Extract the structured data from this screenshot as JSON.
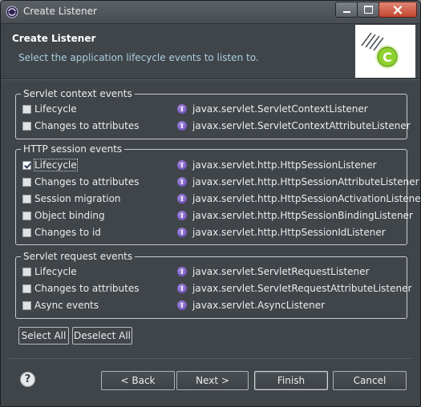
{
  "window": {
    "title": "Create Listener"
  },
  "banner": {
    "title": "Create Listener",
    "description": "Select the application lifecycle events to listen to."
  },
  "groups": [
    {
      "legend": "Servlet context events",
      "rows": [
        {
          "label": "Lifecycle",
          "checked": false,
          "interface": "javax.servlet.ServletContextListener"
        },
        {
          "label": "Changes to attributes",
          "checked": false,
          "interface": "javax.servlet.ServletContextAttributeListener"
        }
      ]
    },
    {
      "legend": "HTTP session events",
      "rows": [
        {
          "label": "Lifecycle",
          "checked": true,
          "interface": "javax.servlet.http.HttpSessionListener"
        },
        {
          "label": "Changes to attributes",
          "checked": false,
          "interface": "javax.servlet.http.HttpSessionAttributeListener"
        },
        {
          "label": "Session migration",
          "checked": false,
          "interface": "javax.servlet.http.HttpSessionActivationListener"
        },
        {
          "label": "Object binding",
          "checked": false,
          "interface": "javax.servlet.http.HttpSessionBindingListener"
        },
        {
          "label": "Changes to id",
          "checked": false,
          "interface": "javax.servlet.http.HttpSessionIdListener"
        }
      ]
    },
    {
      "legend": "Servlet request events",
      "rows": [
        {
          "label": "Lifecycle",
          "checked": false,
          "interface": "javax.servlet.ServletRequestListener"
        },
        {
          "label": "Changes to attributes",
          "checked": false,
          "interface": "javax.servlet.ServletRequestAttributeListener"
        },
        {
          "label": "Async events",
          "checked": false,
          "interface": "javax.servlet.AsyncListener"
        }
      ]
    }
  ],
  "buttons": {
    "select_all": "Select All",
    "deselect_all": "Deselect All",
    "back": "< Back",
    "next": "Next >",
    "finish": "Finish",
    "cancel": "Cancel"
  },
  "icons": {
    "interface": "interface-icon",
    "help": "help-icon",
    "app": "eclipse-icon",
    "banner": "class-wizard-icon"
  },
  "colors": {
    "background": "#40454a",
    "description": "#a9cfe0",
    "interface_icon": "#6a4cc0",
    "banner_icon": "#8fd12f"
  }
}
